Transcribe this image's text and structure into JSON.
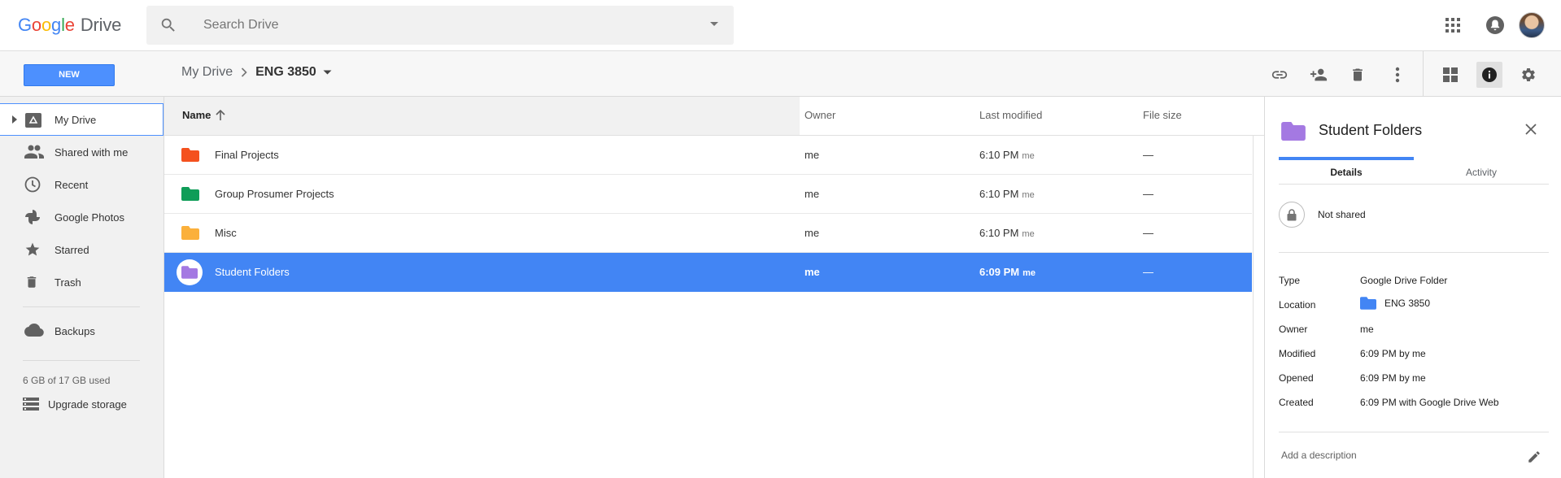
{
  "header": {
    "logo_letters": [
      "G",
      "o",
      "o",
      "g",
      "l",
      "e"
    ],
    "logo_product": "Drive",
    "search_placeholder": "Search Drive"
  },
  "toolbar": {
    "new_label": "NEW",
    "breadcrumb": [
      "My Drive",
      "ENG 3850"
    ],
    "breadcrumb_separator": ">",
    "actions": [
      "get-link-icon",
      "share-icon",
      "trash-icon",
      "more-vert-icon",
      "grid-view-icon",
      "info-icon",
      "settings-icon"
    ]
  },
  "sidebar": {
    "items": [
      {
        "label": "My Drive",
        "icon": "my-drive-icon",
        "selected": true
      },
      {
        "label": "Shared with me",
        "icon": "shared-people-icon"
      },
      {
        "label": "Recent",
        "icon": "clock-icon"
      },
      {
        "label": "Google Photos",
        "icon": "photos-pinwheel-icon"
      },
      {
        "label": "Starred",
        "icon": "star-icon"
      },
      {
        "label": "Trash",
        "icon": "trash-icon"
      },
      {
        "label": "Backups",
        "icon": "cloud-icon"
      }
    ],
    "quota": "6 GB of 17 GB used",
    "upgrade_label": "Upgrade storage"
  },
  "list": {
    "columns": {
      "name": "Name",
      "owner": "Owner",
      "modified": "Last modified",
      "size": "File size"
    },
    "rows": [
      {
        "name": "Final Projects",
        "owner": "me",
        "modified": "6:10 PM",
        "modified_by": "me",
        "size": "—",
        "color": "#f4511e"
      },
      {
        "name": "Group Prosumer Projects",
        "owner": "me",
        "modified": "6:10 PM",
        "modified_by": "me",
        "size": "—",
        "color": "#0f9d58"
      },
      {
        "name": "Misc",
        "owner": "me",
        "modified": "6:10 PM",
        "modified_by": "me",
        "size": "—",
        "color": "#fbb03b"
      },
      {
        "name": "Student Folders",
        "owner": "me",
        "modified": "6:09 PM",
        "modified_by": "me",
        "size": "—",
        "color": "#a479e2",
        "selected": true
      }
    ]
  },
  "details": {
    "title": "Student Folders",
    "tabs": [
      "Details",
      "Activity"
    ],
    "sharing": "Not shared",
    "properties": [
      {
        "label": "Type",
        "value": "Google Drive Folder"
      },
      {
        "label": "Location",
        "value": "ENG 3850"
      },
      {
        "label": "Owner",
        "value": "me"
      },
      {
        "label": "Modified",
        "value": "6:09 PM by me"
      },
      {
        "label": "Opened",
        "value": "6:09 PM by me"
      },
      {
        "label": "Created",
        "value": "6:09 PM with Google Drive Web"
      }
    ],
    "description_placeholder": "Add a description"
  },
  "colors": {
    "accent": "#4285f4",
    "new_button": "#4d90fe",
    "folder_purple": "#a479e2",
    "location_folder": "#4285f4"
  }
}
